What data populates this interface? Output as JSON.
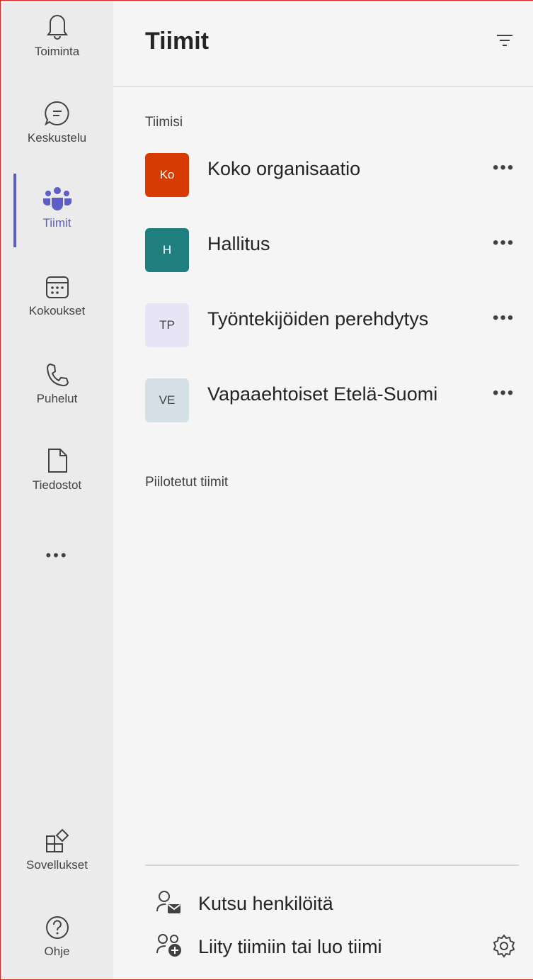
{
  "rail": {
    "items": [
      {
        "label": "Toiminta",
        "icon": "bell-icon"
      },
      {
        "label": "Keskustelu",
        "icon": "chat-icon"
      },
      {
        "label": "Tiimit",
        "icon": "teams-icon",
        "active": true
      },
      {
        "label": "Kokoukset",
        "icon": "calendar-icon"
      },
      {
        "label": "Puhelut",
        "icon": "phone-icon"
      },
      {
        "label": "Tiedostot",
        "icon": "file-icon"
      }
    ],
    "more": "•••",
    "bottom": [
      {
        "label": "Sovellukset",
        "icon": "apps-icon"
      },
      {
        "label": "Ohje",
        "icon": "help-icon"
      }
    ],
    "accent": "#5b5fc7"
  },
  "pane": {
    "title": "Tiimit",
    "section_yours": "Tiimisi",
    "teams": [
      {
        "initials": "Ko",
        "name": "Koko organisaatio",
        "bg": "#d83b01",
        "fg": "#ffffff"
      },
      {
        "initials": "H",
        "name": "Hallitus",
        "bg": "#1f7f7f",
        "fg": "#ffffff"
      },
      {
        "initials": "TP",
        "name": "Työntekijöiden perehdytys",
        "bg": "#e6e4f5",
        "fg": "#424242"
      },
      {
        "initials": "VE",
        "name": "Vapaaehtoiset Etelä-Suomi",
        "bg": "#d5e0e6",
        "fg": "#424242"
      }
    ],
    "more_label": "•••",
    "section_hidden": "Piilotetut tiimit",
    "invite_label": "Kutsu henkilöitä",
    "join_label": "Liity tiimiin tai luo tiimi"
  }
}
